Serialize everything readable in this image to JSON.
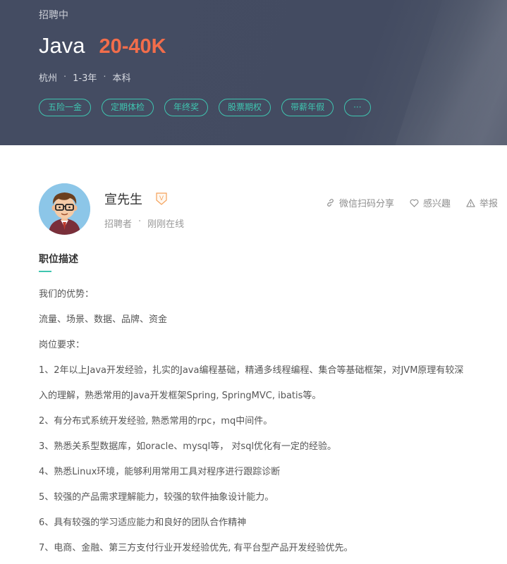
{
  "header": {
    "status": "招聘中",
    "job_title": "Java",
    "salary": "20-40K",
    "meta": {
      "city": "杭州",
      "experience": "1-3年",
      "education": "本科",
      "separator": "·"
    },
    "tags": [
      "五险一金",
      "定期体检",
      "年终奖",
      "股票期权",
      "带薪年假",
      "···"
    ]
  },
  "recruiter": {
    "name": "宣先生",
    "badge": "V",
    "role": "招聘者",
    "separator": "·",
    "online_status": "刚刚在线"
  },
  "actions": {
    "share": "微信扫码分享",
    "interest": "感兴趣",
    "report": "举报"
  },
  "description": {
    "title": "职位描述",
    "lines": [
      "我们的优势：",
      "流量、场景、数据、品牌、资金",
      "岗位要求：",
      "1、2年以上Java开发经验，扎实的Java编程基础，精通多线程编程、集合等基础框架，对JVM原理有较深",
      "入的理解，熟悉常用的Java开发框架Spring, SpringMVC, ibatis等。",
      "2、有分布式系统开发经验, 熟悉常用的rpc，mq中间件。",
      "3、熟悉关系型数据库，如oracle、mysql等， 对sql优化有一定的经验。",
      "4、熟悉Linux环境，能够利用常用工具对程序进行跟踪诊断",
      "5、较强的产品需求理解能力，较强的软件抽象设计能力。",
      "6、具有较强的学习适应能力和良好的团队合作精神",
      "7、电商、金融、第三方支付行业开发经验优先, 有平台型产品开发经验优先。"
    ]
  },
  "colors": {
    "header_bg": "#444c62",
    "salary": "#f26d4b",
    "accent": "#3fc5b0",
    "badge": "#f5a15a"
  },
  "icons": {
    "share": "link-icon",
    "interest": "heart-icon",
    "report": "warning-icon"
  }
}
